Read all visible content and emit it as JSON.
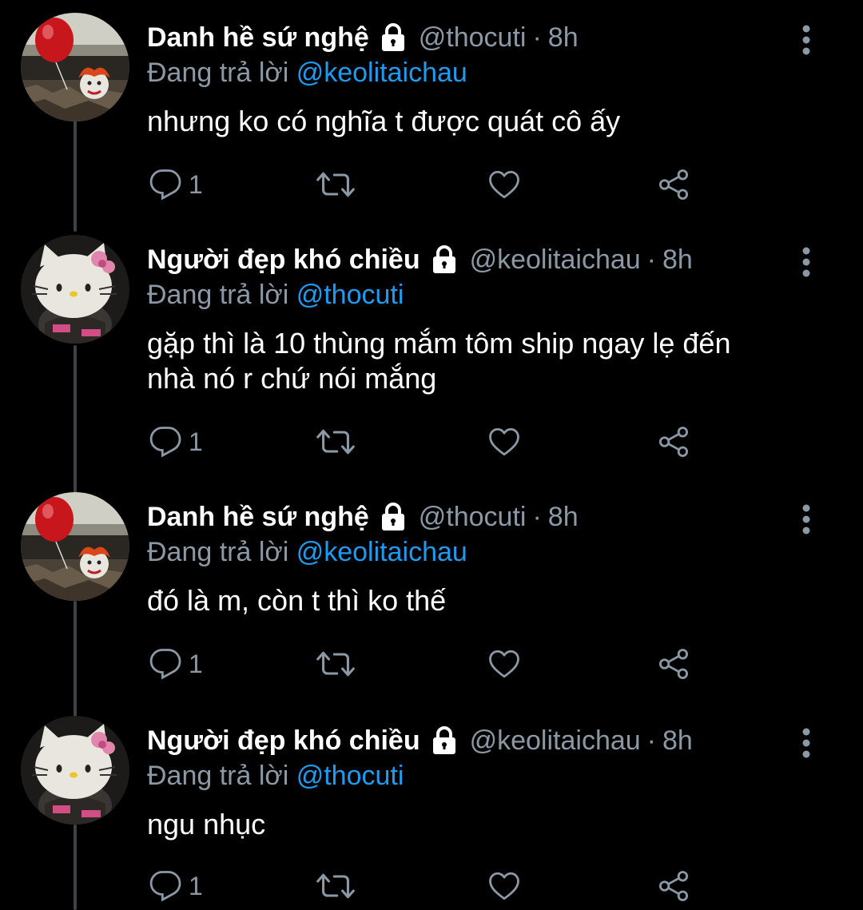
{
  "colors": {
    "background": "#000000",
    "text_primary": "#ffffff",
    "text_secondary": "#8b98a5",
    "link": "#1d9bf0",
    "thread_line": "#3d4248"
  },
  "tweets": [
    {
      "display_name": "Danh hề sứ nghệ",
      "handle": "@thocuti",
      "separator": "·",
      "time": "8h",
      "reply_prefix": "Đang trả lời",
      "reply_to": "@keolitaichau",
      "text": "nhưng ko có nghĩa t được quát cô ấy",
      "reply_count": "1",
      "avatar": "balloon-clown-avatar",
      "protected_icon": "lock-icon"
    },
    {
      "display_name": "Người đẹp khó chiều",
      "handle": "@keolitaichau",
      "separator": "·",
      "time": "8h",
      "reply_prefix": "Đang trả lời",
      "reply_to": "@thocuti",
      "text": "gặp thì là 10 thùng mắm tôm ship ngay lẹ đến nhà nó r chứ nói mắng",
      "reply_count": "1",
      "avatar": "hello-kitty-avatar",
      "protected_icon": "lock-icon"
    },
    {
      "display_name": "Danh hề sứ nghệ",
      "handle": "@thocuti",
      "separator": "·",
      "time": "8h",
      "reply_prefix": "Đang trả lời",
      "reply_to": "@keolitaichau",
      "text": "đó là m, còn t thì ko thế",
      "reply_count": "1",
      "avatar": "balloon-clown-avatar",
      "protected_icon": "lock-icon"
    },
    {
      "display_name": "Người đẹp khó chiều",
      "handle": "@keolitaichau",
      "separator": "·",
      "time": "8h",
      "reply_prefix": "Đang trả lời",
      "reply_to": "@thocuti",
      "text": "ngu nhục",
      "reply_count": "1",
      "avatar": "hello-kitty-avatar",
      "protected_icon": "lock-icon"
    }
  ],
  "action_icons": [
    "reply-icon",
    "retweet-icon",
    "like-icon",
    "share-icon"
  ]
}
